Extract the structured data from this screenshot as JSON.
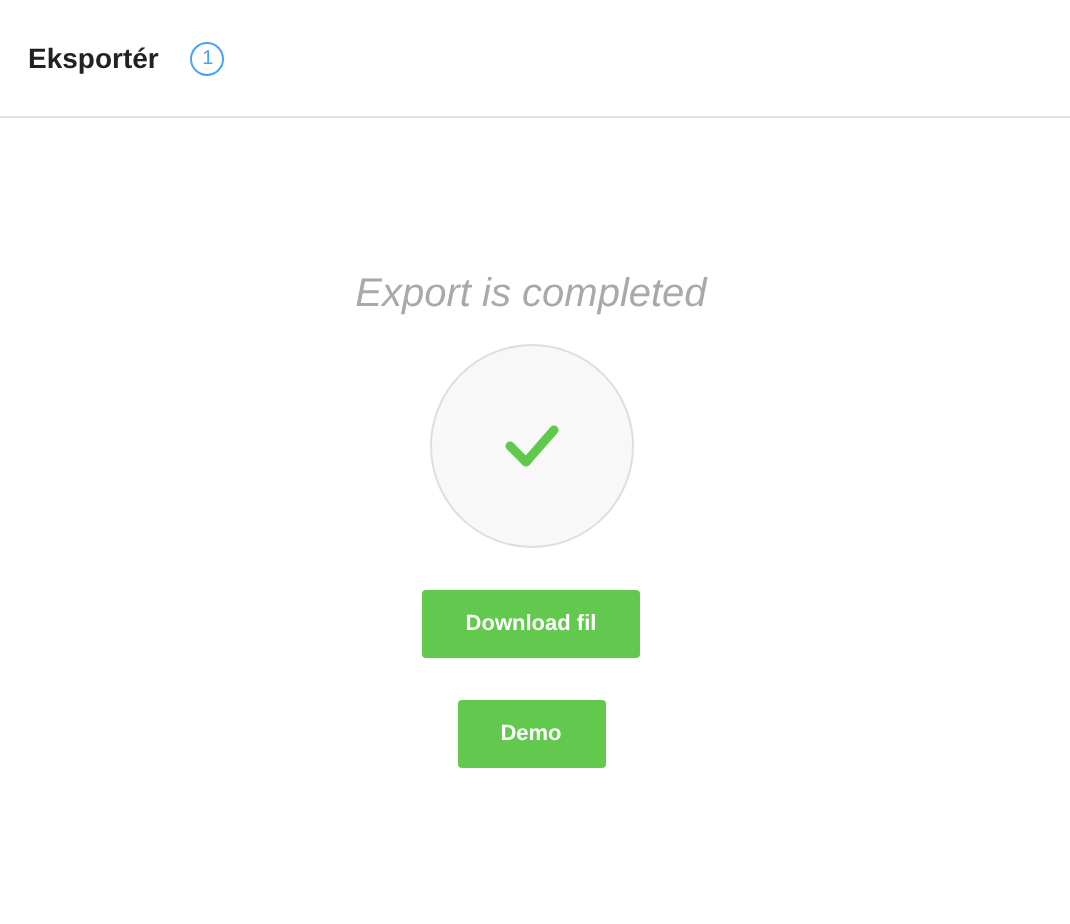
{
  "header": {
    "title": "Eksportér",
    "step": "1"
  },
  "status": {
    "message": "Export is completed",
    "kind": "success"
  },
  "buttons": [
    {
      "label": "Download fil"
    },
    {
      "label": "Demo"
    }
  ]
}
